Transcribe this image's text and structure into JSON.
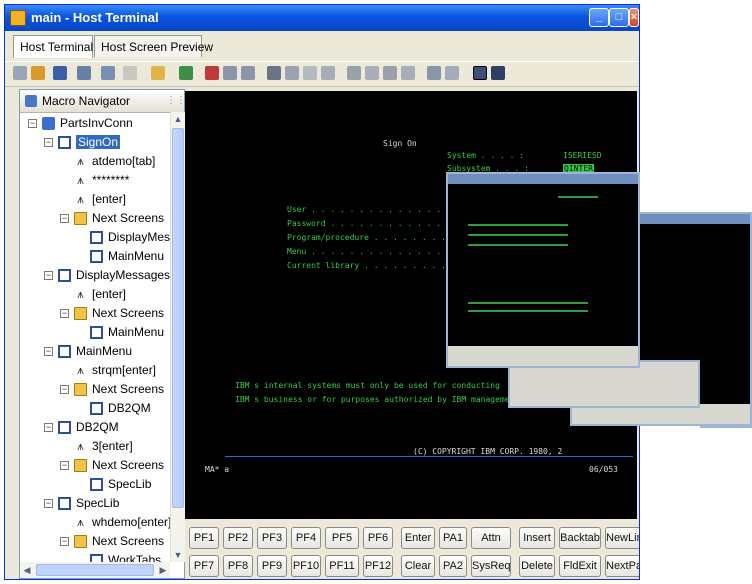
{
  "window": {
    "title": "main - Host Terminal"
  },
  "tabs": [
    "Host Terminal",
    "Host Screen Preview"
  ],
  "navigator": {
    "title": "Macro Navigator",
    "tree": [
      {
        "label": "PartsInvConn",
        "level": 0,
        "icon": "connection-icon",
        "expander": "minus"
      },
      {
        "label": "SignOn",
        "level": 1,
        "icon": "screen-icon",
        "expander": "minus",
        "selected": true
      },
      {
        "label": "atdemo[tab]",
        "level": 2,
        "icon": "action-icon"
      },
      {
        "label": "********",
        "level": 2,
        "icon": "action-icon"
      },
      {
        "label": "[enter]",
        "level": 2,
        "icon": "action-icon"
      },
      {
        "label": "Next Screens",
        "level": 2,
        "icon": "next-screens-icon",
        "expander": "minus"
      },
      {
        "label": "DisplayMessa",
        "level": 3,
        "icon": "screen-icon"
      },
      {
        "label": "MainMenu",
        "level": 3,
        "icon": "screen-icon"
      },
      {
        "label": "DisplayMessages",
        "level": 1,
        "icon": "screen-icon",
        "expander": "minus"
      },
      {
        "label": "[enter]",
        "level": 2,
        "icon": "action-icon"
      },
      {
        "label": "Next Screens",
        "level": 2,
        "icon": "next-screens-icon",
        "expander": "minus"
      },
      {
        "label": "MainMenu",
        "level": 3,
        "icon": "screen-icon"
      },
      {
        "label": "MainMenu",
        "level": 1,
        "icon": "screen-icon",
        "expander": "minus"
      },
      {
        "label": "strqm[enter]",
        "level": 2,
        "icon": "action-icon"
      },
      {
        "label": "Next Screens",
        "level": 2,
        "icon": "next-screens-icon",
        "expander": "minus"
      },
      {
        "label": "DB2QM",
        "level": 3,
        "icon": "screen-icon"
      },
      {
        "label": "DB2QM",
        "level": 1,
        "icon": "screen-icon",
        "expander": "minus"
      },
      {
        "label": "3[enter]",
        "level": 2,
        "icon": "action-icon"
      },
      {
        "label": "Next Screens",
        "level": 2,
        "icon": "next-screens-icon",
        "expander": "minus"
      },
      {
        "label": "SpecLib",
        "level": 3,
        "icon": "screen-icon"
      },
      {
        "label": "SpecLib",
        "level": 1,
        "icon": "screen-icon",
        "expander": "minus"
      },
      {
        "label": "whdemo[enter]",
        "level": 2,
        "icon": "action-icon"
      },
      {
        "label": "Next Screens",
        "level": 2,
        "icon": "next-screens-icon",
        "expander": "minus"
      },
      {
        "label": "WorkTabs",
        "level": 3,
        "icon": "screen-icon"
      }
    ]
  },
  "terminal": {
    "title": "Sign On",
    "system_label": "System . . . . :",
    "system_value": "ISERIESD",
    "subsystem_label": "Subsystem . . . :",
    "subsystem_value": "QINTER",
    "fields": [
      "User . . . . . . . . . . . . . .",
      "Password . . . . . . . . . . . .",
      "Program/procedure . . . . . . . .",
      "Menu . . . . . . . . . . . . . .",
      "Current library . . . . . . . . ."
    ],
    "notice_1": "IBM s internal systems must only be used for conducting",
    "notice_2": "IBM s business or for purposes authorized by IBM management",
    "copyright": "(C) COPYRIGHT IBM CORP. 1980, 2",
    "status_left": "MA*   a",
    "status_right": "06/053"
  },
  "keys": {
    "row1": [
      "PF1",
      "PF2",
      "PF3",
      "PF4",
      "PF5",
      "PF6",
      "Enter",
      "PA1",
      "Attn",
      "Insert",
      "Backtab",
      "NewLine"
    ],
    "row2": [
      "PF7",
      "PF8",
      "PF9",
      "PF10",
      "PF11",
      "PF12",
      "Clear",
      "PA2",
      "SysReq",
      "Delete",
      "FldExit",
      "NextPad"
    ]
  }
}
